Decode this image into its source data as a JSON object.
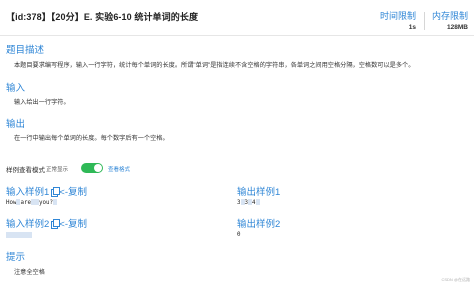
{
  "header": {
    "title": "【id:378】【20分】E. 实验6-10 统计单词的长度",
    "time_limit_label": "时间限制",
    "time_limit_value": "1s",
    "memory_limit_label": "内存限制",
    "memory_limit_value": "128MB"
  },
  "description": {
    "heading": "题目描述",
    "text": "本题目要求编写程序，输入一行字符，统计每个单词的长度。所谓\"单词\"是指连续不含空格的字符串，各单词之间用空格分隔，空格数可以是多个。"
  },
  "input": {
    "heading": "输入",
    "text": "输入给出一行字符。"
  },
  "output": {
    "heading": "输出",
    "text": "在一行中输出每个单词的长度。每个数字后有一个空格。"
  },
  "sample_mode": {
    "label": "样例查看模式",
    "normal_label": "正常显示",
    "toggle_on": true,
    "view_label": "查看格式"
  },
  "samples": [
    {
      "input_heading": "输入样例1",
      "copy_label": "<-复制",
      "input_words": [
        "How",
        "are",
        "you?"
      ],
      "output_heading": "输出样例1",
      "output_values": [
        "3",
        "3",
        "4"
      ]
    },
    {
      "input_heading": "输入样例2",
      "copy_label": "<-复制",
      "output_heading": "输出样例2",
      "output_text": "0"
    }
  ],
  "hint": {
    "heading": "提示",
    "text": "注意全空格"
  },
  "footer": {
    "watermark": "CSDN @在远路"
  },
  "colors": {
    "accent": "#2f86d6",
    "toggle_on": "#2fb957",
    "whitespace_highlight": "#d8e4f3"
  }
}
